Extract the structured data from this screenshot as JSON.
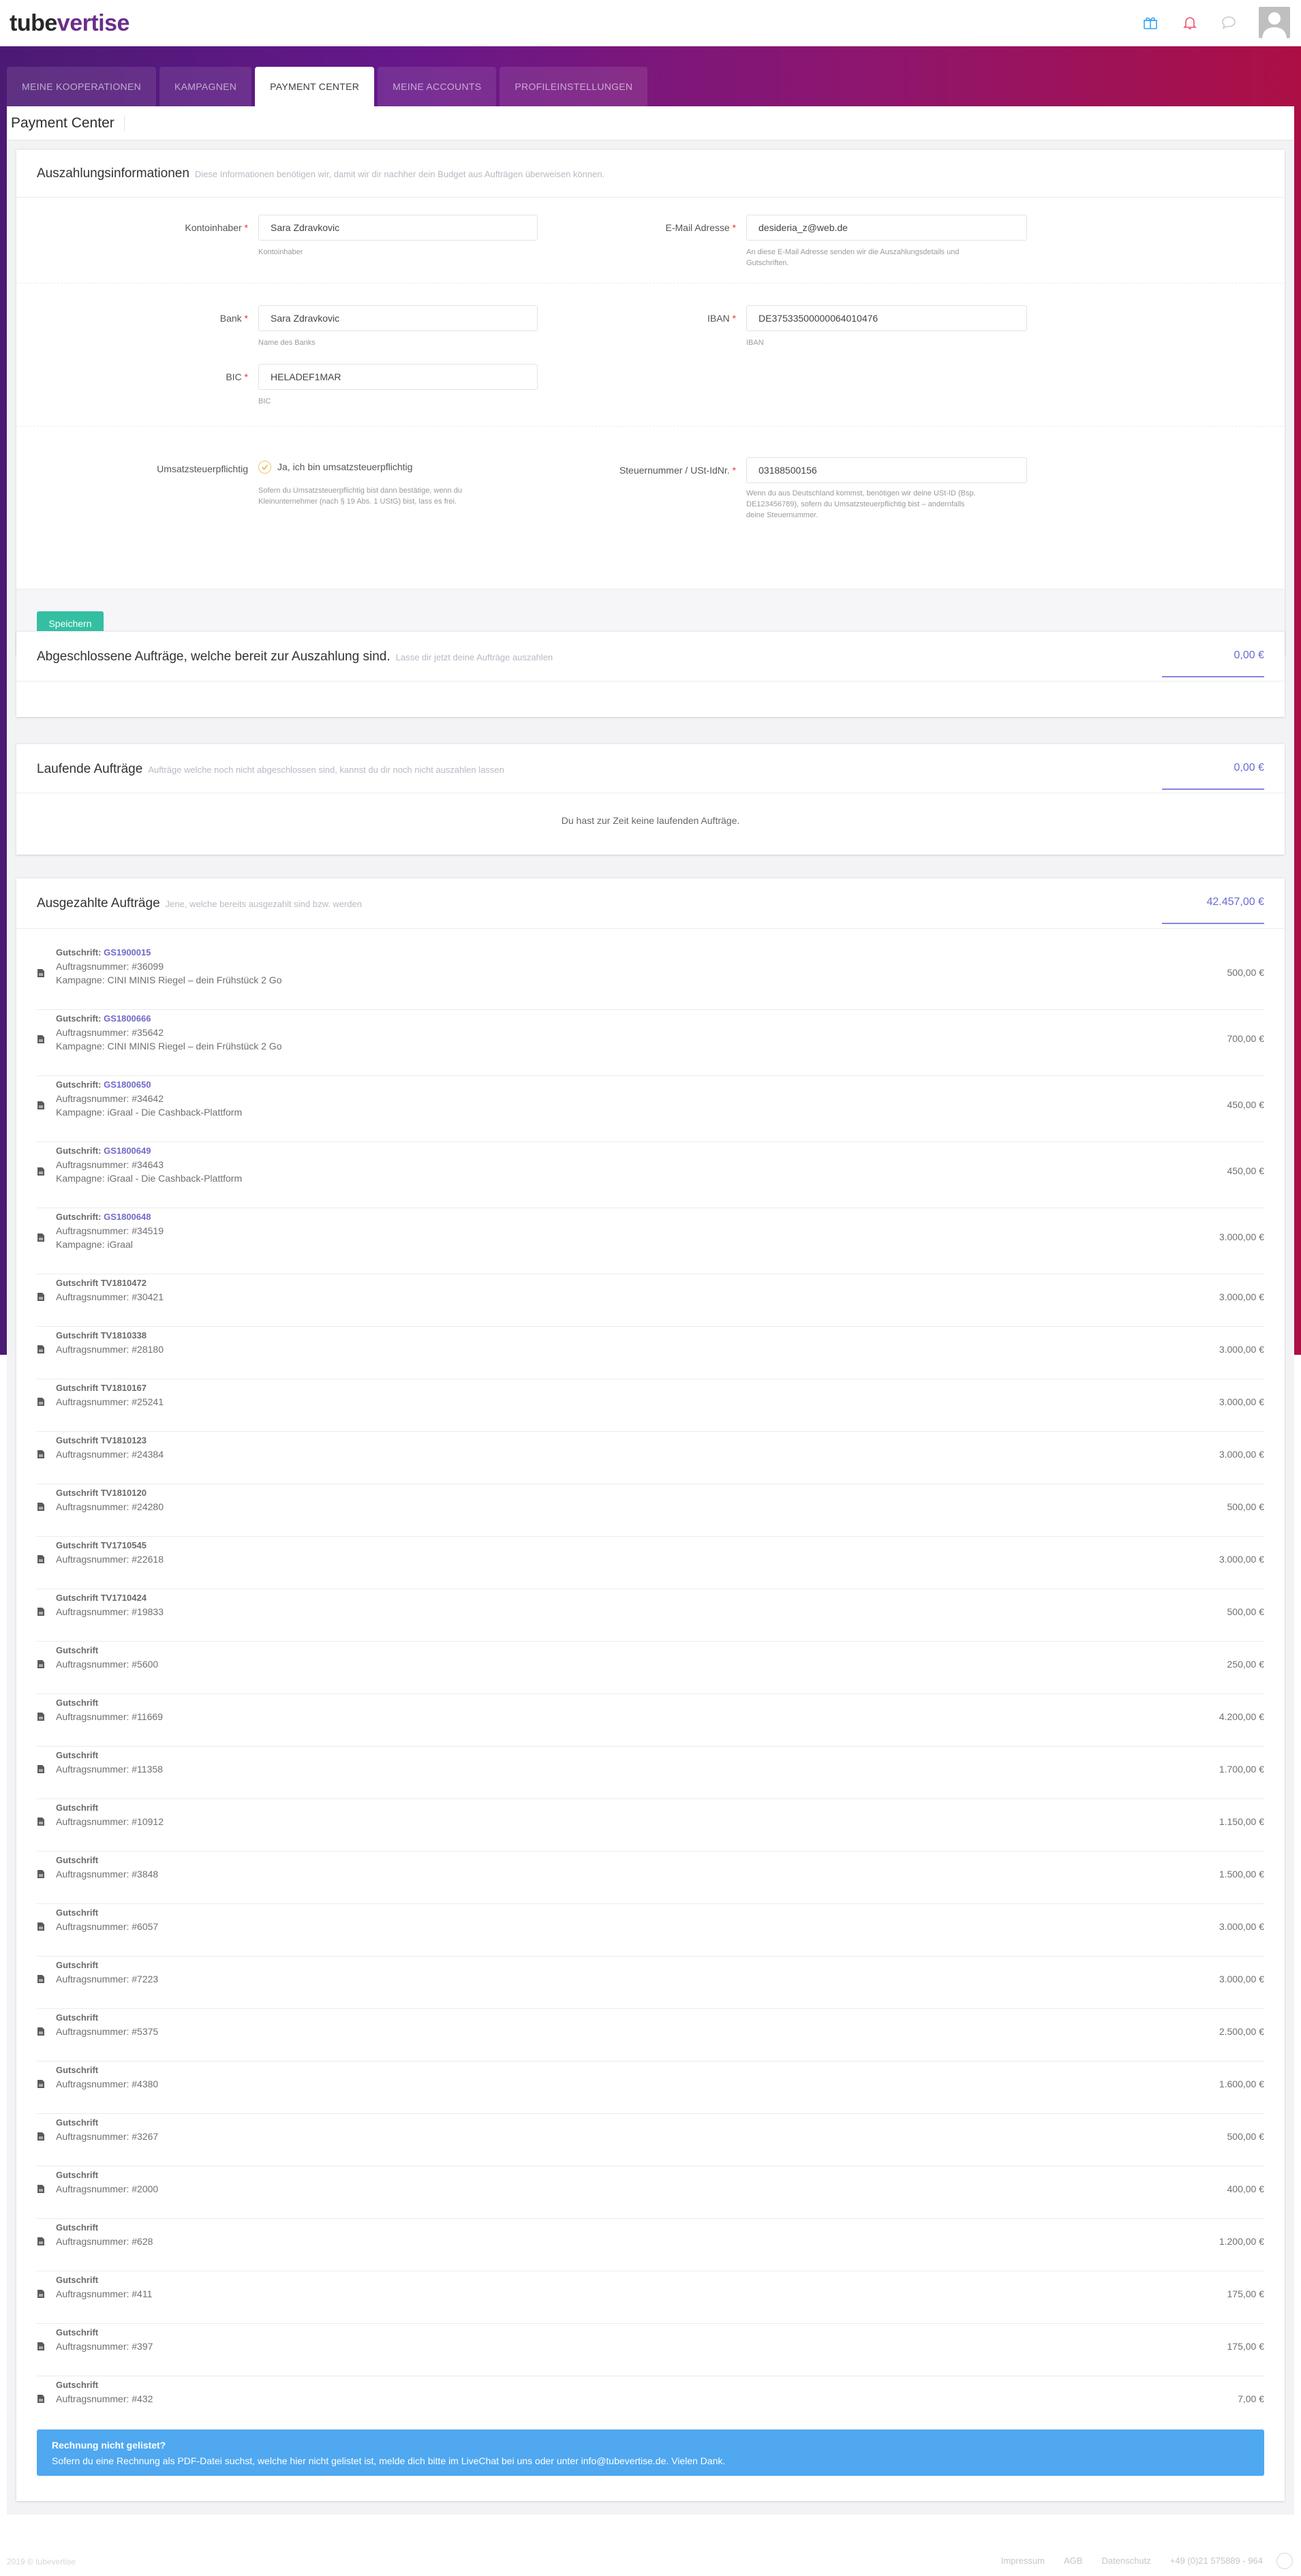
{
  "header": {
    "logo_part1": "tube",
    "logo_part2": "vertise"
  },
  "tabs": [
    {
      "label": "MEINE KOOPERATIONEN"
    },
    {
      "label": "KAMPAGNEN"
    },
    {
      "label": "PAYMENT CENTER"
    },
    {
      "label": "MEINE ACCOUNTS"
    },
    {
      "label": "PROFILEINSTELLUNGEN"
    }
  ],
  "page": {
    "title": "Payment Center"
  },
  "payout_info": {
    "title": "Auszahlungsinformationen",
    "subtitle": "Diese Informationen benötigen wir, damit wir dir nachher dein Budget aus Aufträgen überweisen können.",
    "kontoinhaber": {
      "label": "Kontoinhaber",
      "value": "Sara Zdravkovic",
      "help": "Kontoinhaber"
    },
    "email": {
      "label": "E-Mail Adresse",
      "value": "desideria_z@web.de",
      "help_1": "An diese E-Mail Adresse senden wir die Auszahlungsdetails und",
      "help_2": "Gutschriften."
    },
    "bank": {
      "label": "Bank",
      "value": "Sara Zdravkovic",
      "help": "Name des Banks"
    },
    "iban": {
      "label": "IBAN",
      "value": "DE37533500000064010476",
      "help": "IBAN"
    },
    "bic": {
      "label": "BIC",
      "value": "HELADEF1MAR",
      "help": "BIC"
    },
    "ust": {
      "label": "Umsatzsteuerpflichtig",
      "checkbox_label": "Ja, ich bin umsatzsteuerpflichtig",
      "help_1": "Sofern du Umsatzsteuerpflichtig bist dann bestätige, wenn du",
      "help_2": "Kleinunternehmer (nach § 19 Abs. 1 UStG) bist, lass es frei."
    },
    "steuer": {
      "label": "Steuernummer / USt-IdNr.",
      "value": "03188500156",
      "help_1": "Wenn du aus Deutschland kommst, benötigen wir deine USt-ID (Bsp.",
      "help_2": "DE123456789), sofern du Umsatzsteuerpflichtig bist – andernfalls",
      "help_3": "deine Steuernummer."
    },
    "save_label": "Speichern"
  },
  "completed": {
    "title": "Abgeschlossene Aufträge, welche bereit zur Auszahlung sind.",
    "subtitle": "Lasse dir jetzt deine Aufträge auszahlen",
    "amount": "0,00 €"
  },
  "running": {
    "title": "Laufende Aufträge",
    "subtitle": "Aufträge welche noch nicht abgeschlossen sind, kannst du dir noch nicht auszahlen lassen",
    "amount": "0,00 €",
    "empty": "Du hast zur Zeit keine laufenden Aufträge."
  },
  "paid": {
    "title": "Ausgezahlte Aufträge",
    "subtitle": "Jene, welche bereits ausgezahlt sind bzw. werden",
    "amount": "42.457,00 €",
    "items": [
      {
        "title": "Gutschrift:",
        "code": "GS1900015",
        "order": "Auftragsnummer: #36099",
        "campaign": "Kampagne: CINI MINIS Riegel – dein Frühstück 2 Go",
        "amount": "500,00 €"
      },
      {
        "title": "Gutschrift:",
        "code": "GS1800666",
        "order": "Auftragsnummer: #35642",
        "campaign": "Kampagne: CINI MINIS Riegel – dein Frühstück 2 Go",
        "amount": "700,00 €"
      },
      {
        "title": "Gutschrift:",
        "code": "GS1800650",
        "order": "Auftragsnummer: #34642",
        "campaign": "Kampagne: iGraal - Die Cashback-Plattform",
        "amount": "450,00 €"
      },
      {
        "title": "Gutschrift:",
        "code": "GS1800649",
        "order": "Auftragsnummer: #34643",
        "campaign": "Kampagne: iGraal - Die Cashback-Plattform",
        "amount": "450,00 €"
      },
      {
        "title": "Gutschrift:",
        "code": "GS1800648",
        "order": "Auftragsnummer: #34519",
        "campaign": "Kampagne: iGraal",
        "amount": "3.000,00 €"
      },
      {
        "title": "Gutschrift TV1810472",
        "code": "",
        "order": "Auftragsnummer: #30421",
        "campaign": "",
        "amount": "3.000,00 €"
      },
      {
        "title": "Gutschrift TV1810338",
        "code": "",
        "order": "Auftragsnummer: #28180",
        "campaign": "",
        "amount": "3.000,00 €"
      },
      {
        "title": "Gutschrift TV1810167",
        "code": "",
        "order": "Auftragsnummer: #25241",
        "campaign": "",
        "amount": "3.000,00 €"
      },
      {
        "title": "Gutschrift TV1810123",
        "code": "",
        "order": "Auftragsnummer: #24384",
        "campaign": "",
        "amount": "3.000,00 €"
      },
      {
        "title": "Gutschrift TV1810120",
        "code": "",
        "order": "Auftragsnummer: #24280",
        "campaign": "",
        "amount": "500,00 €"
      },
      {
        "title": "Gutschrift TV1710545",
        "code": "",
        "order": "Auftragsnummer: #22618",
        "campaign": "",
        "amount": "3.000,00 €"
      },
      {
        "title": "Gutschrift TV1710424",
        "code": "",
        "order": "Auftragsnummer: #19833",
        "campaign": "",
        "amount": "500,00 €"
      },
      {
        "title": "Gutschrift",
        "code": "",
        "order": "Auftragsnummer: #5600",
        "campaign": "",
        "amount": "250,00 €"
      },
      {
        "title": "Gutschrift",
        "code": "",
        "order": "Auftragsnummer: #11669",
        "campaign": "",
        "amount": "4.200,00 €"
      },
      {
        "title": "Gutschrift",
        "code": "",
        "order": "Auftragsnummer: #11358",
        "campaign": "",
        "amount": "1.700,00 €"
      },
      {
        "title": "Gutschrift",
        "code": "",
        "order": "Auftragsnummer: #10912",
        "campaign": "",
        "amount": "1.150,00 €"
      },
      {
        "title": "Gutschrift",
        "code": "",
        "order": "Auftragsnummer: #3848",
        "campaign": "",
        "amount": "1.500,00 €"
      },
      {
        "title": "Gutschrift",
        "code": "",
        "order": "Auftragsnummer: #6057",
        "campaign": "",
        "amount": "3.000,00 €"
      },
      {
        "title": "Gutschrift",
        "code": "",
        "order": "Auftragsnummer: #7223",
        "campaign": "",
        "amount": "3.000,00 €"
      },
      {
        "title": "Gutschrift",
        "code": "",
        "order": "Auftragsnummer: #5375",
        "campaign": "",
        "amount": "2.500,00 €"
      },
      {
        "title": "Gutschrift",
        "code": "",
        "order": "Auftragsnummer: #4380",
        "campaign": "",
        "amount": "1.600,00 €"
      },
      {
        "title": "Gutschrift",
        "code": "",
        "order": "Auftragsnummer: #3267",
        "campaign": "",
        "amount": "500,00 €"
      },
      {
        "title": "Gutschrift",
        "code": "",
        "order": "Auftragsnummer: #2000",
        "campaign": "",
        "amount": "400,00 €"
      },
      {
        "title": "Gutschrift",
        "code": "",
        "order": "Auftragsnummer: #628",
        "campaign": "",
        "amount": "1.200,00 €"
      },
      {
        "title": "Gutschrift",
        "code": "",
        "order": "Auftragsnummer: #411",
        "campaign": "",
        "amount": "175,00 €"
      },
      {
        "title": "Gutschrift",
        "code": "",
        "order": "Auftragsnummer: #397",
        "campaign": "",
        "amount": "175,00 €"
      },
      {
        "title": "Gutschrift",
        "code": "",
        "order": "Auftragsnummer: #432",
        "campaign": "",
        "amount": "7,00 €"
      }
    ],
    "notice_title": "Rechnung nicht gelistet?",
    "notice_body": "Sofern du eine Rechnung als PDF-Datei suchst, welche hier nicht gelistet ist, melde dich bitte im LiveChat bei uns oder unter info@tubevertise.de. Vielen Dank."
  },
  "footer": {
    "left": "2019 © tubevertise",
    "links": [
      "Impressum",
      "AGB",
      "Datenschutz",
      "+49 (0)21 575889 - 964"
    ]
  },
  "colors": {
    "accent": "#716aca",
    "save_button": "#34bfa3",
    "notice": "#4fa8f0",
    "hero_start": "#4b1a73",
    "hero_end": "#ad0f45"
  },
  "icons": [
    "gift-icon",
    "bell-icon",
    "chat-icon",
    "avatar",
    "pdf-icon"
  ]
}
